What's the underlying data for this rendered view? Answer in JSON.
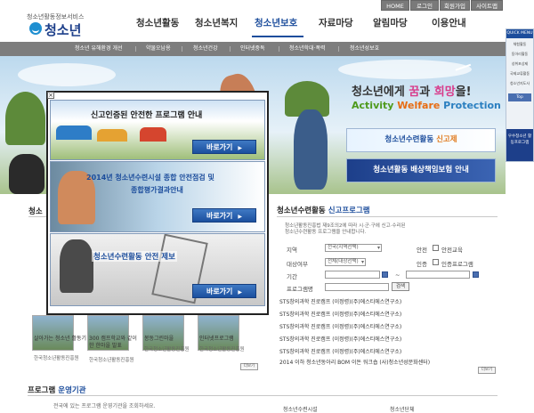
{
  "header": {
    "brand_sub": "청소년활동정보서비스",
    "logo_text": "청소년",
    "util": [
      "HOME",
      "로그인",
      "회원가입",
      "사이트맵"
    ],
    "gnb": [
      "청소년활동",
      "청소년복지",
      "청소년보호",
      "자료마당",
      "알림마당",
      "이용안내"
    ]
  },
  "subnav": [
    "청소년 유해환경 개선",
    "약물오남용",
    "청소년건강",
    "인터넷중독",
    "청소년학대·폭력",
    "청소년성보호"
  ],
  "hero": {
    "title_a": "청소년에게 ",
    "title_hl1": "꿈",
    "title_b": "과 ",
    "title_hl2": "희망",
    "title_c": "을!",
    "eng_a": "Activity ",
    "eng_w": "Welfare ",
    "eng_p": "Protection",
    "banner1_a": "청소년수련활동 ",
    "banner1_b": "신고제",
    "banner2": "청소년활동 배상책임보험 안내"
  },
  "quick": {
    "head": "QUICK MENU",
    "items": [
      "체험활동",
      "동아리활동",
      "성취포상제",
      "국제교류활동",
      "청소년지도사"
    ],
    "top": "Top",
    "banner": "우수청소년 활동프로그램"
  },
  "popup": {
    "close": "×",
    "panel1_title": "신고인증된 안전한 프로그램 안내",
    "panel2_title_1": "2014년 청소년수련시설 종합 안전점검 및",
    "panel2_title_2": "종합평가결과안내",
    "panel3_title": "청소년수련활동 안전 제보",
    "button": "바로가기"
  },
  "left_section": {
    "title": "청소",
    "thumbs": [
      {
        "cap": "살아가는 청소년 활동기",
        "sub": "한국청소년활동진흥원"
      },
      {
        "cap": "300 캠프학교와 같이 한 한마을 발표",
        "sub": "한국청소년활동진흥원"
      },
      {
        "cap": "봉동그린마을",
        "sub": "한국청소년활동진흥원"
      },
      {
        "cap": "인터넷프로그램",
        "sub": "한국청소년활동진흥원"
      }
    ],
    "more": "더보기"
  },
  "report_section": {
    "title_a": "청소년수련활동 ",
    "title_b": "신고프로그램",
    "desc_1": "청소년활동진흥법 제9조의2에 따라 시·군·구에 신고·수리된",
    "desc_2": "청소년수련활동 프로그램을 안내합니다.",
    "region_label": "지역",
    "region_value": "전국(지역선택)",
    "safety_label": "안전",
    "safety_option": "안전교육",
    "target_label": "대상여부",
    "target_value": "전체(대상선택)",
    "cert_label": "인증",
    "cert_option": "인증프로그램",
    "period_label": "기간",
    "program_label": "프로그램명",
    "search_button": "검색",
    "list": [
      "STS창의과학 진로캠프 (이정령)(주)에스티에스연구소)",
      "STS창의과학 진로캠프 (이정령)(주)에스티에스연구소)",
      "STS창의과학 진로캠프 (이정령)(주)에스티에스연구소)",
      "STS창의과학 진로캠프 (이정령)(주)에스티에스연구소)",
      "STS창의과학 진로캠프 (이정령)(주)에스티에스연구소)",
      "2014 이하 청소년동아리 BOM 이돈 워크숍 (사)청소년성문화센터)"
    ],
    "more": "더보기"
  },
  "bottom_section": {
    "title_a": "프로그램 ",
    "title_b": "운영기관",
    "desc": "전국에 있는 프로그램 운영기관을 조회하세요.",
    "col1": "청소년수련시설",
    "col2": "청소년단체"
  }
}
